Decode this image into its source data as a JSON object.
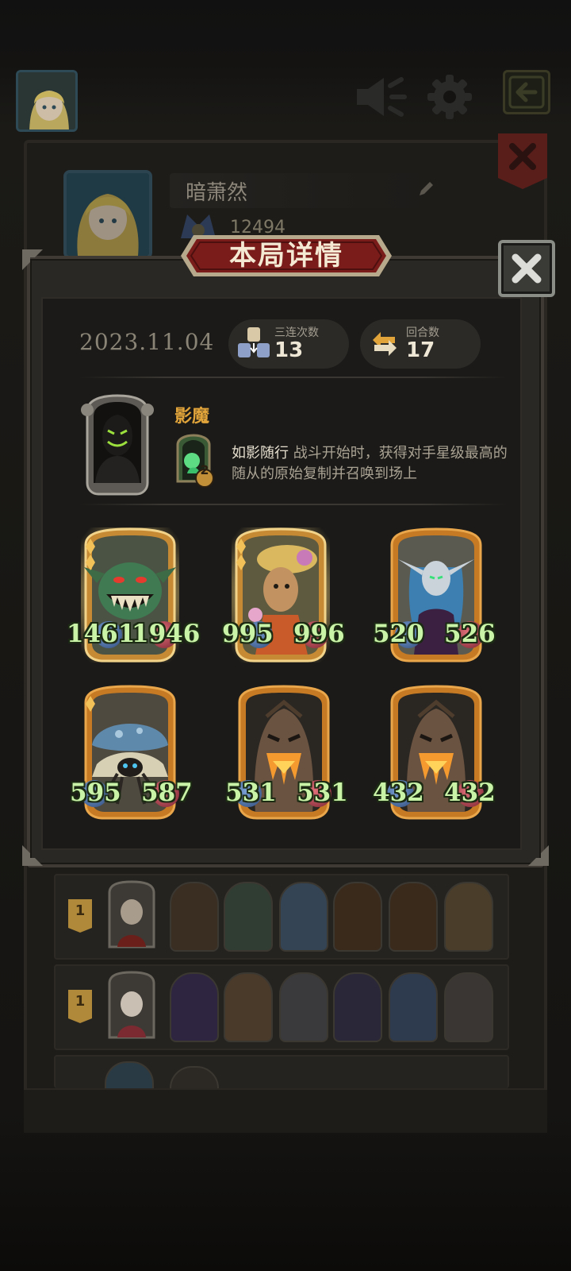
{
  "header": {
    "player_name": "暗萧然",
    "player_score": "12494"
  },
  "modal": {
    "title": "本局详情",
    "date": "2023.11.04",
    "stats": [
      {
        "label": "三连次数",
        "value": "13",
        "icon": "triple-units-icon"
      },
      {
        "label": "回合数",
        "value": "17",
        "icon": "rounds-cycle-icon"
      }
    ],
    "hero": {
      "name": "影魔",
      "skill_level": "2",
      "skill_name": "如影随行",
      "skill_desc": " 战斗开始时，获得对手星级最高的随从的原始复制并召唤到场上"
    },
    "cards": [
      {
        "attack": "1461",
        "health": "1946",
        "golden": true,
        "art": "goblin-monster"
      },
      {
        "attack": "995",
        "health": "996",
        "golden": true,
        "art": "scarecrow-girl"
      },
      {
        "attack": "520",
        "health": "526",
        "golden": false,
        "art": "elf-sorceress"
      },
      {
        "attack": "595",
        "health": "587",
        "golden": false,
        "art": "mushroom-spider"
      },
      {
        "attack": "531",
        "health": "531",
        "golden": false,
        "art": "treant"
      },
      {
        "attack": "432",
        "health": "432",
        "golden": false,
        "art": "treant"
      }
    ]
  },
  "history": [
    {
      "rank": "1"
    },
    {
      "rank": "1"
    },
    {
      "rank": ""
    }
  ],
  "colors": {
    "attack_text": "#c9f4a7",
    "gold_frame": "#d89a3a",
    "hero_name": "#e0a43a",
    "title_plate": "#7a1c1a"
  }
}
